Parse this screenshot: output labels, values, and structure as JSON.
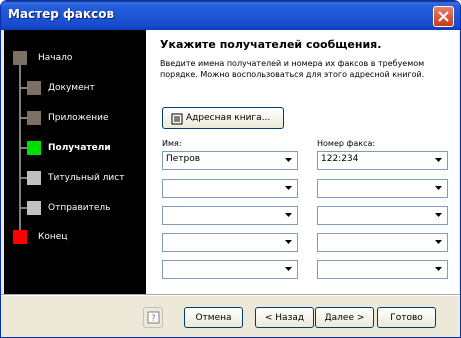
{
  "window": {
    "title": "Мастер факсов"
  },
  "sidebar": {
    "steps": [
      {
        "label": "Начало",
        "color": "#7b7063"
      },
      {
        "label": "Документ",
        "color": "#7b7063"
      },
      {
        "label": "Приложение",
        "color": "#7b7063"
      },
      {
        "label": "Получатели",
        "color": "#00dd00",
        "current": true
      },
      {
        "label": "Титульный лист",
        "color": "#c0c0c0"
      },
      {
        "label": "Отправитель",
        "color": "#c0c0c0"
      },
      {
        "label": "Конец",
        "color": "#ff0000"
      }
    ]
  },
  "main": {
    "heading": "Укажите получателей сообщения.",
    "description": "Введите имена получателей и номера их факсов в требуемом порядке. Можно воспользоваться для этого адресной книгой.",
    "address_book_button": "Адресная книга...",
    "name_label": "Имя:",
    "fax_label": "Номер факса:",
    "rows": [
      {
        "name": "Петров",
        "fax": "122:234"
      },
      {
        "name": "",
        "fax": ""
      },
      {
        "name": "",
        "fax": ""
      },
      {
        "name": "",
        "fax": ""
      },
      {
        "name": "",
        "fax": ""
      }
    ]
  },
  "footer": {
    "help_icon": "help-icon",
    "cancel": "Отмена",
    "back": "< Назад",
    "next": "Далее >",
    "finish": "Готово"
  },
  "colors": {
    "accent": "#245edb",
    "sidebar_bg": "#000000"
  }
}
